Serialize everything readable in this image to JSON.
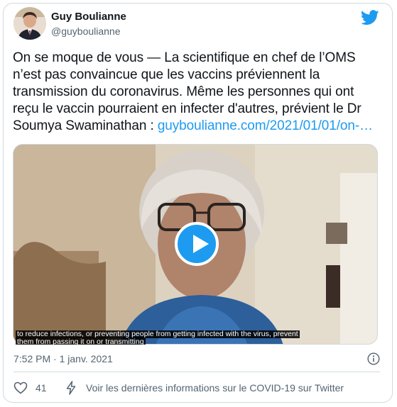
{
  "author": {
    "name": "Guy Boulianne",
    "handle": "@guyboulianne"
  },
  "tweet": {
    "text_lines": [
      "On se moque de vous — La scientifique en chef de l’OMS",
      "n’est pas convaincue que les vaccins préviennent la",
      "transmission du coronavirus. Même les personnes qui ont",
      "reçu le vaccin pourraient en infecter d'autres, prévient le Dr",
      "Soumya Swaminathan : "
    ],
    "link": "guyboulianne.com/2021/01/01/on-…",
    "timestamp": "7:52 PM · 1 janv. 2021"
  },
  "media": {
    "caption_line1": "to reduce infections, or preventing people from getting infected with the virus, prevent",
    "caption_line2": "them from passing it on or transmitting"
  },
  "footer": {
    "likes": "41",
    "covid_link": "Voir les dernières informations sur le COVID-19 sur Twitter"
  },
  "colors": {
    "accent": "#1d9bf0",
    "muted": "#536471",
    "border": "#cfd9de"
  },
  "icons": {
    "brand": "twitter-bird-icon",
    "play": "play-icon",
    "info": "info-icon",
    "like": "heart-icon",
    "covid": "lightning-bolt-icon"
  }
}
